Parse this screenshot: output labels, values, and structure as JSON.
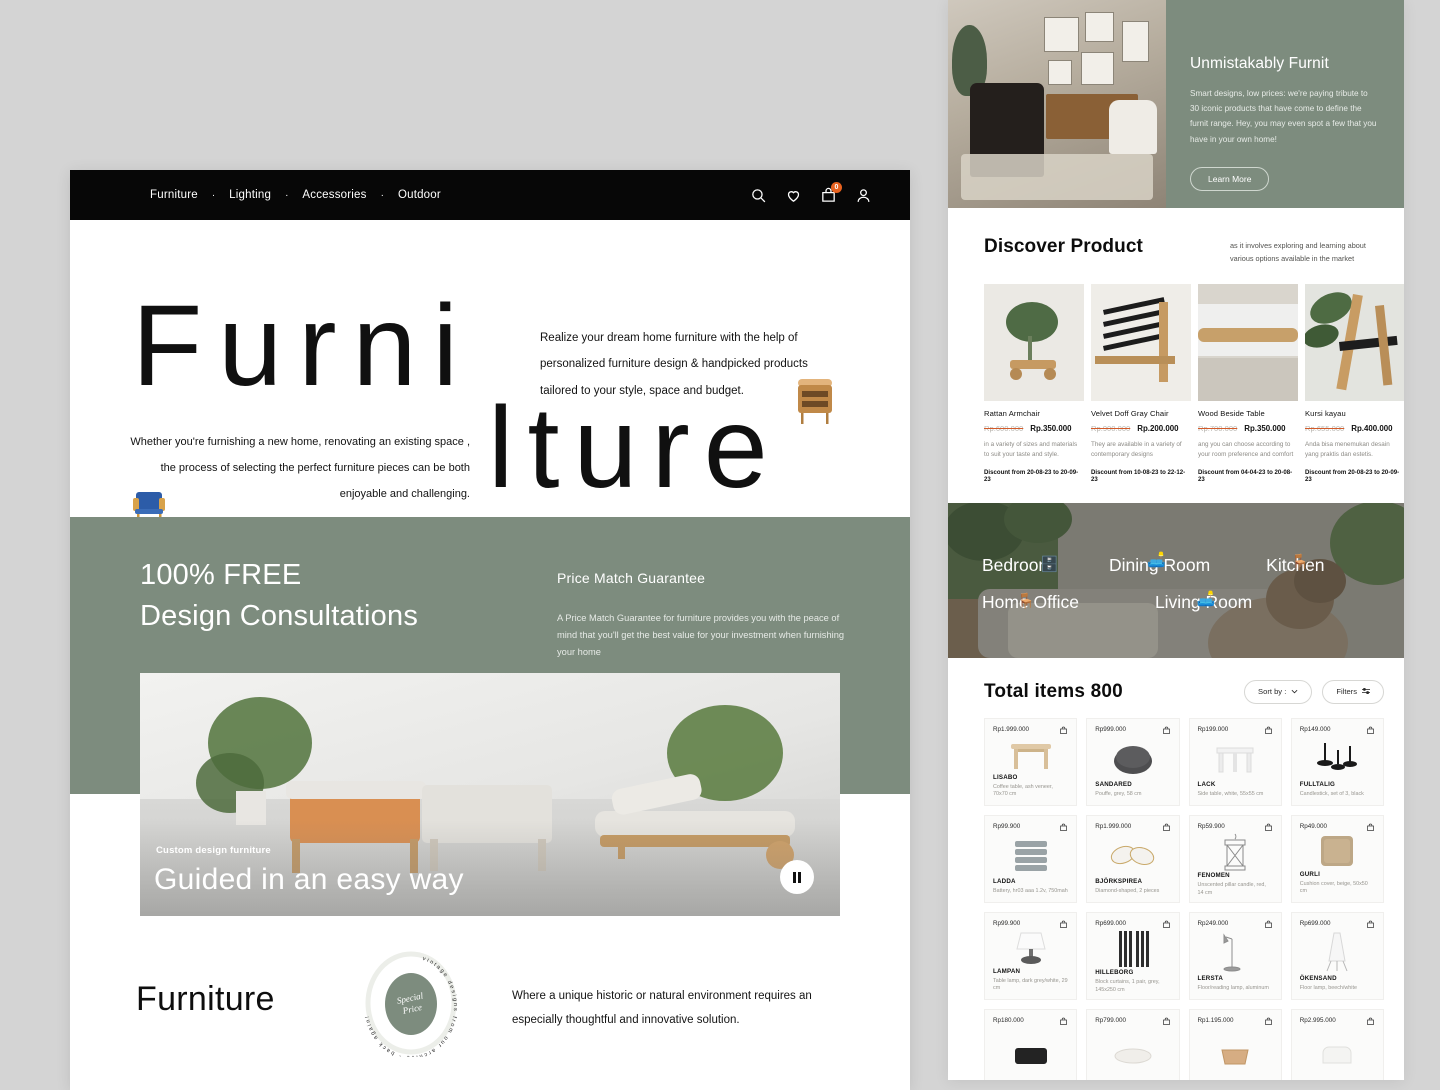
{
  "nav": {
    "links": [
      "Furniture",
      "Lighting",
      "Accessories",
      "Outdoor"
    ],
    "separator": "·",
    "cart_count": "0",
    "icons": [
      "search-icon",
      "heart-icon",
      "bag-icon",
      "user-icon"
    ]
  },
  "hero": {
    "word_1": "Furni",
    "word_2": "lture",
    "right_paragraph": "Realize your dream home furniture with the help of personalized furniture design & handpicked products tailored to your style, space and budget.",
    "left_paragraph": "Whether you're furnishing a new home, renovating an existing space , the process of selecting the perfect furniture pieces can be both enjoyable and challenging."
  },
  "consult": {
    "title_line_1": "100% FREE",
    "title_line_2": "Design Consultations",
    "pmg_title": "Price Match Guarantee",
    "pmg_body": "A Price Match Guarantee for furniture provides you with the peace of mind that you'll get the best value for your investment when furnishing your home"
  },
  "video": {
    "kicker": "Custom design furniture",
    "headline": "Guided in an easy way",
    "control": "pause-button"
  },
  "footer": {
    "word": "Furniture",
    "badge_ring_text": "vintage designs from our archive - back again!",
    "badge_inner_line_1": "Special",
    "badge_inner_line_2": "Price",
    "paragraph": "Where a unique historic or natural environment requires an especially thoughtful and innovative solution."
  },
  "promo": {
    "title": "Unmistakably Furnit",
    "body": "Smart designs, low prices: we're paying tribute to 30 iconic products that have come to define the furnit range. Hey, you may even spot a few that you have in your own home!",
    "button": "Learn More"
  },
  "discover": {
    "title": "Discover Product",
    "subtitle": "as it involves exploring and learning about various options available in the market",
    "products": [
      {
        "name": "Rattan Armchair",
        "price_old": "Rp.600.000",
        "price_new": "Rp.350.000",
        "desc": "in a variety of sizes and materials to suit your taste and style.",
        "discount": "Discount from 20-08-23 to 20-09-23"
      },
      {
        "name": "Velvet Doff Gray Chair",
        "price_old": "Rp.900.000",
        "price_new": "Rp.200.000",
        "desc": "They are available in a variety of contemporary designs",
        "discount": "Discount from 10-08-23 to 22-12-23"
      },
      {
        "name": "Wood Beside Table",
        "price_old": "Rp.700.000",
        "price_new": "Rp.350.000",
        "desc": "ang you can choose according to your room preference and comfort",
        "discount": "Discount from 04-04-23 to 20-08-23"
      },
      {
        "name": "Kursi kayau",
        "price_old": "Rp.655.000",
        "price_new": "Rp.400.000",
        "desc": "Anda bisa menemukan desain yang praktis dan estetis.",
        "discount": "Discount from 20-08-23 to 20-09-23"
      }
    ]
  },
  "rooms": {
    "row_1": [
      {
        "label": "Bedroom",
        "emoji": "🗄️"
      },
      {
        "label": "Dining Room",
        "emoji": "🛋️"
      },
      {
        "label": "Kitchen",
        "emoji": "🪑"
      }
    ],
    "row_2": [
      {
        "label": "Home Office",
        "emoji": "🪑"
      },
      {
        "label": "Living Room",
        "emoji": "🛋️"
      }
    ]
  },
  "totals": {
    "title": "Total items 800",
    "sort_label": "Sort by :",
    "filters_label": "Filters"
  },
  "items": [
    {
      "price": "Rp1.999.000",
      "name": "LISABO",
      "desc": "Coffee table, ash veneer, 70x70 cm",
      "thumb": "table"
    },
    {
      "price": "Rp999.000",
      "name": "SANDARED",
      "desc": "Pouffe, grey, 58 cm",
      "thumb": "pouffe"
    },
    {
      "price": "Rp199.000",
      "name": "LACK",
      "desc": "Side table, white, 55x55 cm",
      "thumb": "sidetable"
    },
    {
      "price": "Rp149.000",
      "name": "FULLTALIG",
      "desc": "Candlestick, set of 3, black",
      "thumb": "candles"
    },
    {
      "price": "Rp99.900",
      "name": "LADDA",
      "desc": "Battery, hr03 aaa 1.2v, 750mah",
      "thumb": "battery"
    },
    {
      "price": "Rp1.999.000",
      "name": "BJÖRKSPIREA",
      "desc": "Diamond-shaped, 2 pieces",
      "thumb": "diamond"
    },
    {
      "price": "Rp59.900",
      "name": "FENOMEN",
      "desc": "Unscented pillar candle, red, 14 cm",
      "thumb": "lantern"
    },
    {
      "price": "Rp49.000",
      "name": "GURLI",
      "desc": "Cushion cover, beige, 50x50 cm",
      "thumb": "cushion"
    },
    {
      "price": "Rp99.900",
      "name": "LAMPAN",
      "desc": "Table lamp, dark grey/white, 29 cm",
      "thumb": "tablelamp"
    },
    {
      "price": "Rp699.000",
      "name": "HILLEBORG",
      "desc": "Block curtains, 1 pair, grey, 145x250 cm",
      "thumb": "curtain"
    },
    {
      "price": "Rp249.000",
      "name": "LERSTA",
      "desc": "Floor/reading lamp, aluminum",
      "thumb": "readinglamp"
    },
    {
      "price": "Rp699.000",
      "name": "ÖKENSAND",
      "desc": "Floor lamp, beech/white",
      "thumb": "floorlamp"
    },
    {
      "price": "Rp180.000",
      "name": "",
      "desc": "",
      "thumb": "box"
    },
    {
      "price": "Rp799.000",
      "name": "",
      "desc": "",
      "thumb": "plate"
    },
    {
      "price": "Rp1.195.000",
      "name": "",
      "desc": "",
      "thumb": "basket"
    },
    {
      "price": "Rp2.995.000",
      "name": "",
      "desc": "",
      "thumb": "chairwhite"
    }
  ],
  "colors": {
    "sage": "#7d8c7e",
    "black": "#070707",
    "badge_orange": "#e8621f",
    "page_bg": "#d4d4d4"
  }
}
